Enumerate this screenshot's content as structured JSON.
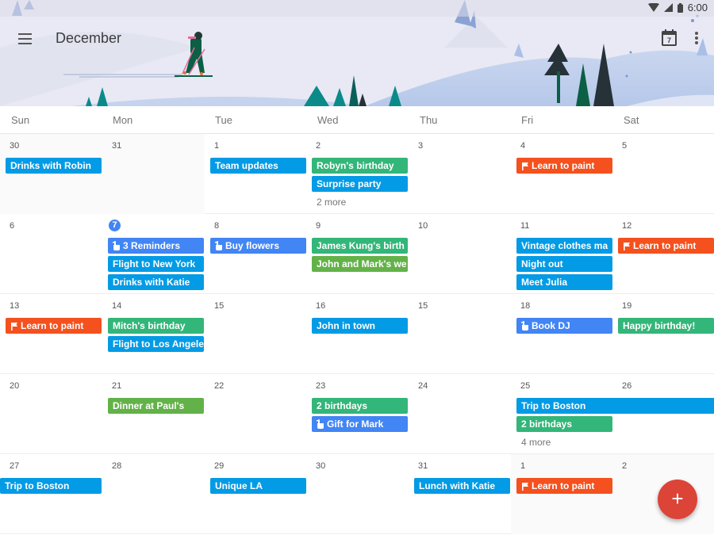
{
  "status_bar": {
    "time": "6:00",
    "icons": [
      "wifi-icon",
      "signal-icon",
      "battery-icon"
    ]
  },
  "toolbar": {
    "title": "December",
    "menu_icon": "hamburger-menu-icon",
    "today_icon_label": "7",
    "more_icon": "more-vert-icon"
  },
  "weekdays": [
    "Sun",
    "Mon",
    "Tue",
    "Wed",
    "Thu",
    "Fri",
    "Sat"
  ],
  "colors": {
    "blue": "#039be5",
    "reminder": "#4285f4",
    "green": "#33b679",
    "olive": "#63b249",
    "orange": "#f4511e",
    "fab": "#db4437",
    "today": "#4285f4"
  },
  "fab": {
    "label": "+",
    "icon": "add-icon"
  },
  "weeks": [
    {
      "days": [
        {
          "num": "30",
          "other": true,
          "events": [
            {
              "title": "Drinks with Robin",
              "color": "blue"
            }
          ]
        },
        {
          "num": "31",
          "other": true,
          "events": []
        },
        {
          "num": "1",
          "events": [
            {
              "title": "Team updates",
              "color": "blue"
            }
          ]
        },
        {
          "num": "2",
          "events": [
            {
              "title": "Robyn's birthday",
              "color": "green"
            },
            {
              "title": "Surprise party",
              "color": "blue"
            }
          ],
          "more": "2 more"
        },
        {
          "num": "3",
          "events": []
        },
        {
          "num": "4",
          "events": [
            {
              "title": "Learn to paint",
              "color": "orange",
              "icon": "flag"
            }
          ]
        },
        {
          "num": "5",
          "events": []
        }
      ]
    },
    {
      "days": [
        {
          "num": "6",
          "events": []
        },
        {
          "num": "7",
          "today": true,
          "events": [
            {
              "title": "3 Reminders",
              "color": "reminder",
              "icon": "reminder"
            },
            {
              "title": "Flight to New York",
              "color": "blue"
            },
            {
              "title": "Drinks with Katie",
              "color": "blue"
            }
          ]
        },
        {
          "num": "8",
          "events": [
            {
              "title": "Buy flowers",
              "color": "reminder",
              "icon": "reminder"
            }
          ]
        },
        {
          "num": "9",
          "events": [
            {
              "title": "James Kung's birth",
              "color": "green"
            },
            {
              "title": "John and Mark's we",
              "color": "olive"
            }
          ]
        },
        {
          "num": "10",
          "events": []
        },
        {
          "num": "11",
          "events": [
            {
              "title": "Vintage clothes ma",
              "color": "blue"
            },
            {
              "title": "Night out",
              "color": "blue"
            },
            {
              "title": "Meet Julia",
              "color": "blue"
            }
          ]
        },
        {
          "num": "12",
          "events": [
            {
              "title": "Learn to paint",
              "color": "orange",
              "icon": "flag"
            }
          ]
        }
      ]
    },
    {
      "days": [
        {
          "num": "13",
          "events": [
            {
              "title": "Learn to paint",
              "color": "orange",
              "icon": "flag"
            }
          ]
        },
        {
          "num": "14",
          "events": [
            {
              "title": "Mitch's birthday",
              "color": "green"
            },
            {
              "title": "Flight to Los Angele",
              "color": "blue"
            }
          ]
        },
        {
          "num": "15",
          "events": []
        },
        {
          "num": "16",
          "events": [
            {
              "title": "John in town",
              "color": "blue"
            }
          ]
        },
        {
          "num": "15",
          "events": []
        },
        {
          "num": "18",
          "events": [
            {
              "title": "Book DJ",
              "color": "reminder",
              "icon": "reminder"
            }
          ]
        },
        {
          "num": "19",
          "events": [
            {
              "title": "Happy birthday!",
              "color": "green"
            }
          ]
        }
      ]
    },
    {
      "days": [
        {
          "num": "20",
          "events": []
        },
        {
          "num": "21",
          "events": [
            {
              "title": "Dinner at Paul's",
              "color": "olive"
            }
          ]
        },
        {
          "num": "22",
          "events": []
        },
        {
          "num": "23",
          "events": [
            {
              "title": "2 birthdays",
              "color": "green"
            },
            {
              "title": "Gift for Mark",
              "color": "reminder",
              "icon": "reminder"
            }
          ]
        },
        {
          "num": "24",
          "events": []
        },
        {
          "num": "25",
          "events": [
            {
              "title": "Trip to Boston",
              "color": "blue",
              "span": 2
            },
            {
              "title": "2 birthdays",
              "color": "green"
            }
          ],
          "more": "4 more"
        },
        {
          "num": "26",
          "events": []
        }
      ]
    },
    {
      "days": [
        {
          "num": "27",
          "events": [
            {
              "title": "Trip to Boston",
              "color": "blue",
              "continued": true
            }
          ]
        },
        {
          "num": "28",
          "events": []
        },
        {
          "num": "29",
          "events": [
            {
              "title": "Unique LA",
              "color": "blue"
            }
          ]
        },
        {
          "num": "30",
          "events": []
        },
        {
          "num": "31",
          "events": [
            {
              "title": "Lunch with Katie",
              "color": "blue"
            }
          ]
        },
        {
          "num": "1",
          "other": true,
          "events": [
            {
              "title": "Learn to paint",
              "color": "orange",
              "icon": "flag"
            }
          ]
        },
        {
          "num": "2",
          "other": true,
          "events": []
        }
      ]
    }
  ]
}
